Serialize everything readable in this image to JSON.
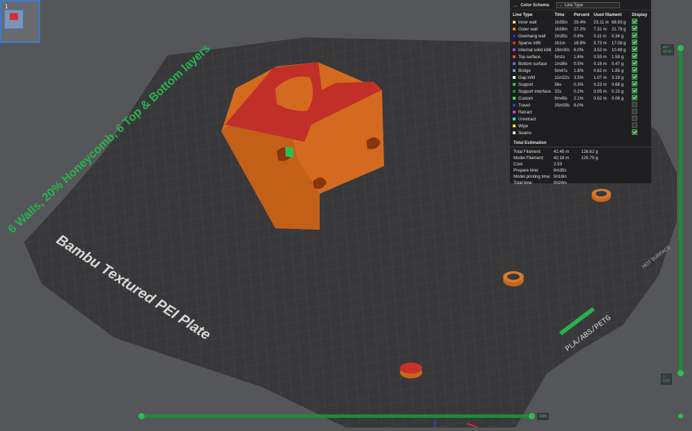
{
  "thumbnail": {
    "plate_number": "1"
  },
  "plate": {
    "name_text": "Bambu Textured PEI Plate",
    "side_label": "PLA/ABS/PETG",
    "surface_label": "HOT SURFACE"
  },
  "model_annotation": "6 Walls, 20% Honeycomb, 6 Top & Bottom layers",
  "panel": {
    "title": "Color Scheme",
    "scheme_value": "Line Type",
    "columns": {
      "line_type": "Line Type",
      "time": "Time",
      "percent": "Percent",
      "used": "Used filament",
      "display": "Display"
    },
    "rows": [
      {
        "label": "Inner wall",
        "time": "1h35m",
        "percent": "29.4%",
        "length": "23.11 m",
        "weight": "68.93 g",
        "color": "#f2e063",
        "display": true
      },
      {
        "label": "Outer wall",
        "time": "1h28m",
        "percent": "27.2%",
        "length": "7.31 m",
        "weight": "21.79 g",
        "color": "#f08a2a",
        "display": true
      },
      {
        "label": "Overhang wall",
        "time": "2m35s",
        "percent": "0.8%",
        "length": "0.11 m",
        "weight": "0.34 g",
        "color": "#2030c8",
        "display": true
      },
      {
        "label": "Sparse infill",
        "time": "1h1m",
        "percent": "18.8%",
        "length": "5.73 m",
        "weight": "17.08 g",
        "color": "#b53b3b",
        "display": true
      },
      {
        "label": "Internal solid infill",
        "time": "19m30s",
        "percent": "6.0%",
        "length": "3.52 m",
        "weight": "10.49 g",
        "color": "#9b4fd0",
        "display": true
      },
      {
        "label": "Top surface",
        "time": "5m1s",
        "percent": "1.6%",
        "length": "0.53 m",
        "weight": "1.59 g",
        "color": "#e24a4a",
        "display": true
      },
      {
        "label": "Bottom surface",
        "time": "1m36s",
        "percent": "0.5%",
        "length": "0.16 m",
        "weight": "0.47 g",
        "color": "#6a6ae0",
        "display": true
      },
      {
        "label": "Bridge",
        "time": "5m47s",
        "percent": "1.8%",
        "length": "0.62 m",
        "weight": "1.85 g",
        "color": "#6ea3c8",
        "display": true
      },
      {
        "label": "Gap infill",
        "time": "11m22s",
        "percent": "3.5%",
        "length": "1.07 m",
        "weight": "3.19 g",
        "color": "#ffffff",
        "display": true
      },
      {
        "label": "Support",
        "time": "56s",
        "percent": "0.3%",
        "length": "0.23 m",
        "weight": "0.68 g",
        "color": "#2ecc40",
        "display": true
      },
      {
        "label": "Support interface",
        "time": "32s",
        "percent": "0.2%",
        "length": "0.05 m",
        "weight": "0.15 g",
        "color": "#1e8a2c",
        "display": true
      },
      {
        "label": "Custom",
        "time": "6m49s",
        "percent": "2.1%",
        "length": "0.02 m",
        "weight": "0.06 g",
        "color": "#5dd67a",
        "display": true
      },
      {
        "label": "Travel",
        "time": "25m59s",
        "percent": "8.0%",
        "length": "",
        "weight": "",
        "color": "#1e4ca0",
        "display": false
      },
      {
        "label": "Retract",
        "time": "",
        "percent": "",
        "length": "",
        "weight": "",
        "color": "#d040d0",
        "display": false
      },
      {
        "label": "Unretract",
        "time": "",
        "percent": "",
        "length": "",
        "weight": "",
        "color": "#40d0d0",
        "display": false
      },
      {
        "label": "Wipe",
        "time": "",
        "percent": "",
        "length": "",
        "weight": "",
        "color": "#f0f040",
        "display": false
      },
      {
        "label": "Seams",
        "time": "",
        "percent": "",
        "length": "",
        "weight": "",
        "color": "#f5f5f5",
        "display": true
      }
    ],
    "estimation": {
      "title": "Total Estimation",
      "total_filament_label": "Total Filament:",
      "total_filament_length": "42.45 m",
      "total_filament_weight": "126.62 g",
      "model_filament_label": "Model Filament:",
      "model_filament_length": "42.18 m",
      "model_filament_weight": "125.79 g",
      "cost_label": "Cost:",
      "cost_value": "2.53",
      "prepare_label": "Prepare time:",
      "prepare_value": "6m35s",
      "model_time_label": "Model printing time:",
      "model_time_value": "5h18m",
      "total_time_label": "Total time:",
      "total_time_value": "5h24m"
    }
  },
  "layer_slider": {
    "top_layer": "447",
    "top_height": "90.04",
    "bottom_layer": "1",
    "bottom_height": "0.20"
  },
  "move_slider": {
    "value": "4380"
  },
  "colors": {
    "accent": "#2ebd50",
    "model_body": "#d2691e",
    "model_top": "#c0302e",
    "bed": "#3a3a3d"
  }
}
